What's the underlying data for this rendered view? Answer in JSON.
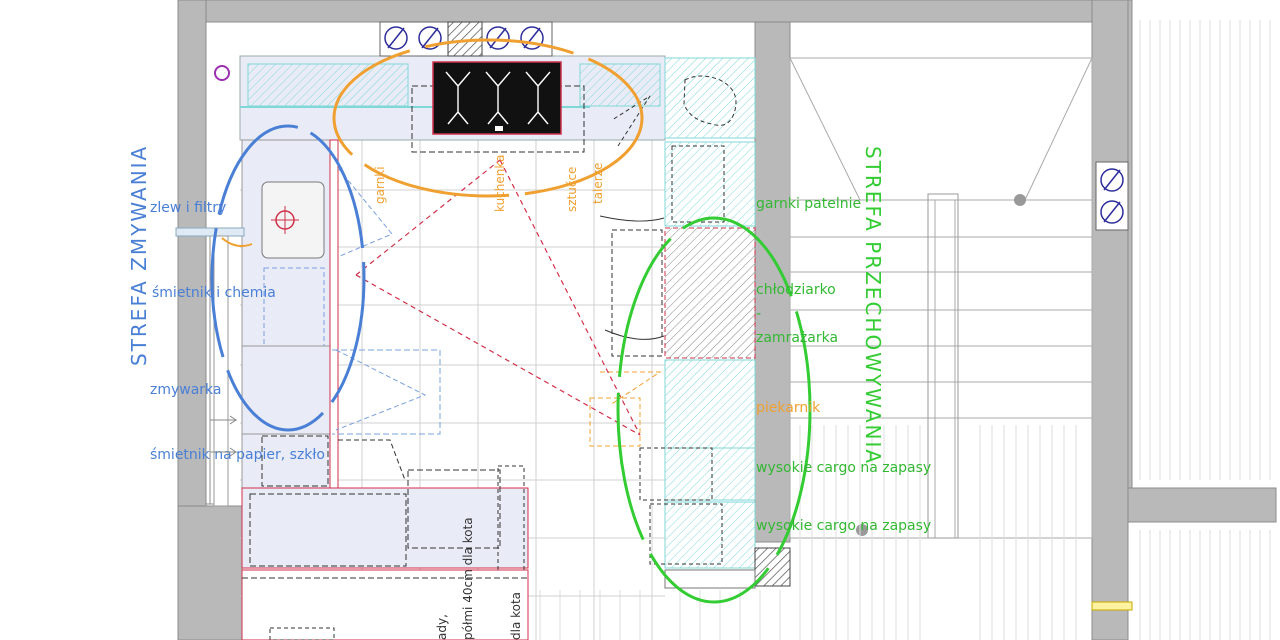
{
  "colors": {
    "wall": "#b9b9b9",
    "wall_edge": "#8c8c8c",
    "grid": "#c8c8c8",
    "blue": "#4a7fd6",
    "orange": "#f0a030",
    "green": "#33cc33",
    "red": "#d0304a",
    "cyan": "#7fd7d7",
    "cabinet": "#e9ecf7"
  },
  "zones": {
    "washing": {
      "title": "STREFA ZMYWANIA",
      "labels": [
        "zlew i filtry",
        "śmietnik i chemia",
        "zmywarka",
        "śmietnik na papier, szkło"
      ]
    },
    "cooking": {
      "labels": [
        "garnki",
        "kuchenka",
        "sztućce",
        "talerze"
      ]
    },
    "storage": {
      "title": "STREFA PRZECHOWYWANIA",
      "labels": [
        "garnki patelnie",
        "chłodziarko",
        "-",
        "zamrażarka",
        "piekarnik",
        "wysokie cargo na zapasy",
        "wysokie cargo na zapasy"
      ]
    }
  },
  "bottom_labels": {
    "shelf": "półmi 40cm dla kota",
    "cat": "dla kota",
    "misc": "ady,"
  }
}
